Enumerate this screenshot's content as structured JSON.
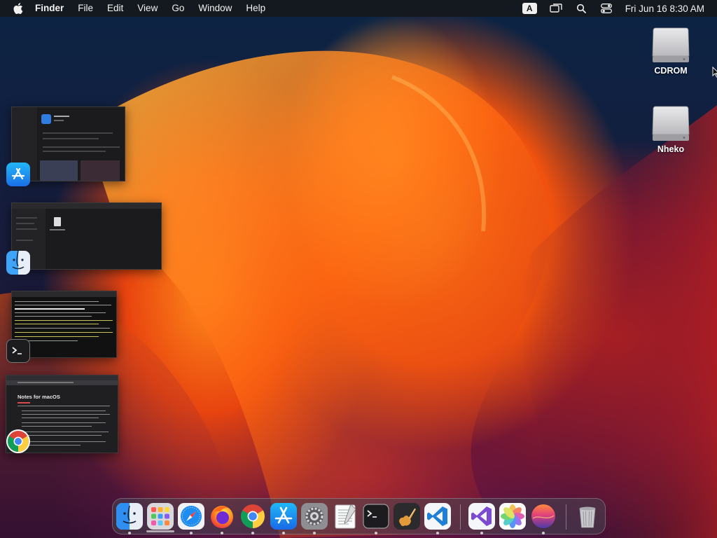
{
  "menubar": {
    "app_name": "Finder",
    "items": [
      "File",
      "Edit",
      "View",
      "Go",
      "Window",
      "Help"
    ],
    "input_source": "A",
    "clock": "Fri Jun 16  8:30 AM"
  },
  "desktop": {
    "disks": [
      {
        "label": "CDROM"
      },
      {
        "label": "Nheko"
      }
    ]
  },
  "windows": [
    {
      "app": "App Store",
      "icon": "app-store-icon"
    },
    {
      "app": "Finder",
      "icon": "finder-icon"
    },
    {
      "app": "Terminal",
      "icon": "terminal-icon"
    },
    {
      "app": "Google Chrome",
      "icon": "chrome-icon",
      "page_title": "Notes for macOS"
    }
  ],
  "dock": {
    "items": [
      {
        "name": "Finder",
        "icon": "finder-icon",
        "running": true
      },
      {
        "name": "Launchpad",
        "icon": "launchpad-icon",
        "running": false
      },
      {
        "name": "Safari",
        "icon": "safari-icon",
        "running": true
      },
      {
        "name": "Firefox",
        "icon": "firefox-icon",
        "running": true
      },
      {
        "name": "Google Chrome",
        "icon": "chrome-icon",
        "running": true
      },
      {
        "name": "App Store",
        "icon": "app-store-icon",
        "running": true
      },
      {
        "name": "System Preferences",
        "icon": "system-preferences-icon",
        "running": true
      },
      {
        "name": "TextEdit",
        "icon": "textedit-icon",
        "running": false
      },
      {
        "name": "Terminal",
        "icon": "terminal-icon",
        "running": true
      },
      {
        "name": "GarageBand",
        "icon": "garageband-icon",
        "running": false
      },
      {
        "name": "Visual Studio Code",
        "icon": "vscode-icon",
        "running": true
      },
      {
        "name": "Visual Studio",
        "icon": "visual-studio-icon",
        "running": true
      },
      {
        "name": "Photos",
        "icon": "photos-icon",
        "running": false
      },
      {
        "name": "macOS Installer",
        "icon": "macos-installer-icon",
        "running": true
      },
      {
        "name": "Trash",
        "icon": "trash-icon",
        "running": false
      }
    ]
  }
}
